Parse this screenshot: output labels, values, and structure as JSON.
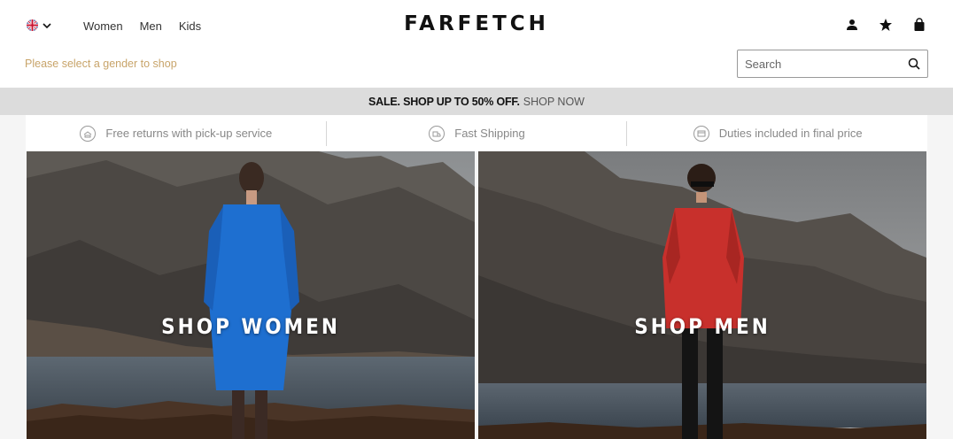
{
  "header": {
    "locale_flag": "uk-flag-icon",
    "nav": [
      "Women",
      "Men",
      "Kids"
    ],
    "logo": "FARFETCH",
    "gender_prompt": "Please select a gender to shop",
    "search_placeholder": "Search",
    "tools": [
      "account-icon",
      "wishlist-star-icon",
      "bag-icon"
    ]
  },
  "promo": {
    "sale_text": "SALE. SHOP UP TO 50% OFF.",
    "link": "SHOP NOW"
  },
  "benefits": [
    {
      "icon": "returns-icon",
      "label": "Free returns with pick-up service"
    },
    {
      "icon": "shipping-icon",
      "label": "Fast Shipping"
    },
    {
      "icon": "duties-icon",
      "label": "Duties included in final price"
    }
  ],
  "panels": {
    "women": "SHOP WOMEN",
    "men": "SHOP MEN"
  },
  "colors": {
    "gender_prompt": "#c8a46a",
    "promo_bg": "#dcdcdc",
    "women_coat": "#1e6fd0",
    "men_shirt": "#c8302c"
  }
}
